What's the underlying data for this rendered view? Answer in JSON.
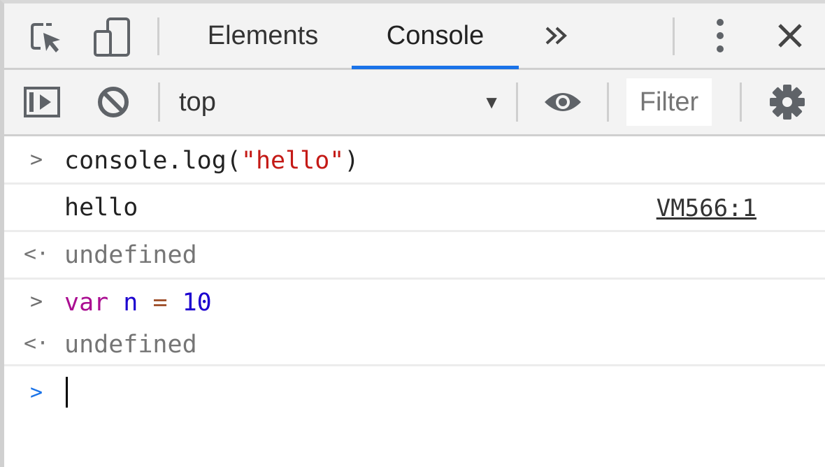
{
  "tabs": {
    "items": [
      {
        "label": "Elements",
        "active": false
      },
      {
        "label": "Console",
        "active": true
      }
    ],
    "more_label": "»",
    "accent_color": "#1a73e8"
  },
  "icons": {
    "inspect": "inspect-element-icon",
    "device": "device-toolbar-icon",
    "more_tabs": "chevron-double-right-icon",
    "menu": "vertical-dots-icon",
    "close": "close-icon",
    "sidebar": "show-sidebar-icon",
    "clear": "clear-console-icon",
    "eye": "live-expression-eye-icon",
    "settings": "gear-icon"
  },
  "toolbar": {
    "context": "top",
    "filter_placeholder": "Filter"
  },
  "console": {
    "entries": [
      {
        "kind": "input",
        "tokens": [
          {
            "t": "console.log(",
            "c": "plain"
          },
          {
            "t": "\"hello\"",
            "c": "str"
          },
          {
            "t": ")",
            "c": "plain"
          }
        ]
      },
      {
        "kind": "log",
        "text": "hello",
        "source": "VM566:1"
      },
      {
        "kind": "result",
        "text": "undefined"
      },
      {
        "kind": "input",
        "tokens": [
          {
            "t": "var",
            "c": "kw"
          },
          {
            "t": " ",
            "c": "plain"
          },
          {
            "t": "n",
            "c": "var"
          },
          {
            "t": " ",
            "c": "plain"
          },
          {
            "t": "=",
            "c": "op"
          },
          {
            "t": " ",
            "c": "plain"
          },
          {
            "t": "10",
            "c": "num"
          }
        ]
      },
      {
        "kind": "result",
        "text": "undefined"
      }
    ],
    "prompt_color": "#1a73e8"
  }
}
